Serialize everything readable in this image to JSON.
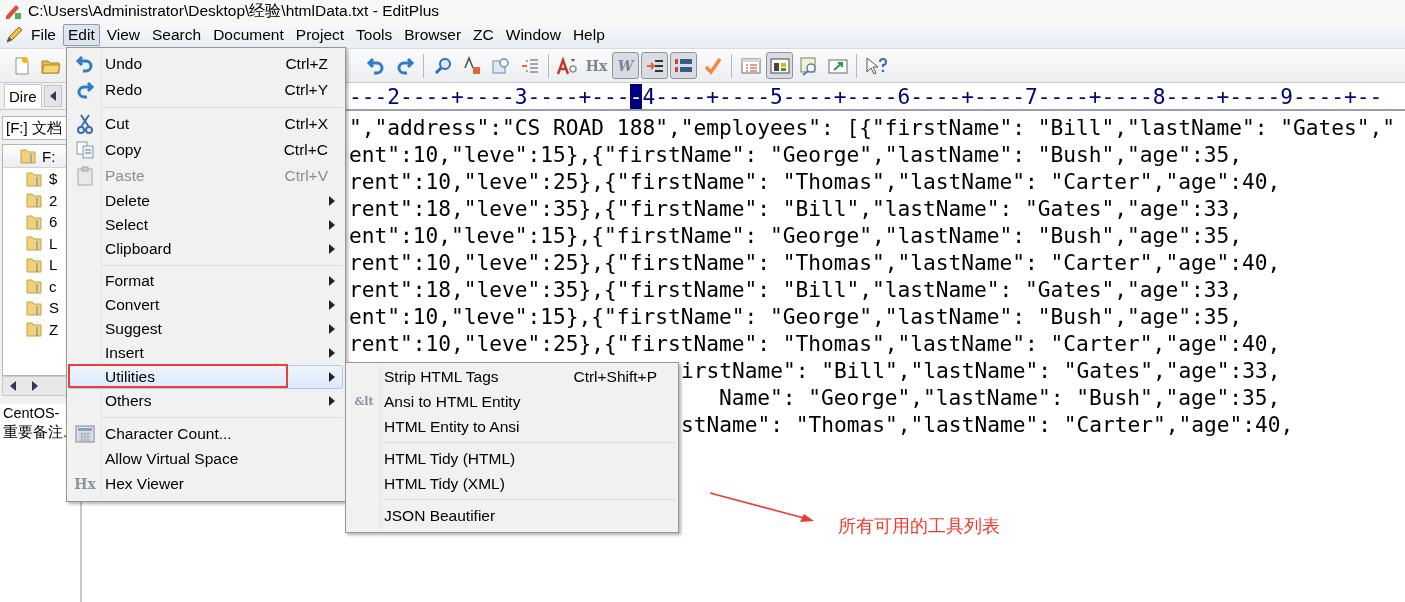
{
  "window": {
    "title": "C:\\Users\\Administrator\\Desktop\\经验\\htmlData.txt - EditPlus"
  },
  "menu_bar": [
    {
      "label": "File",
      "selected": false
    },
    {
      "label": "Edit",
      "selected": true
    },
    {
      "label": "View",
      "selected": false
    },
    {
      "label": "Search",
      "selected": false
    },
    {
      "label": "Document",
      "selected": false
    },
    {
      "label": "Project",
      "selected": false
    },
    {
      "label": "Tools",
      "selected": false
    },
    {
      "label": "Browser",
      "selected": false
    },
    {
      "label": "ZC",
      "selected": false
    },
    {
      "label": "Window",
      "selected": false
    },
    {
      "label": "Help",
      "selected": false
    }
  ],
  "toolbar_left": [
    {
      "kind": "button",
      "pressed": false
    },
    {
      "kind": "button",
      "pressed": false
    }
  ],
  "toolbar": [
    {
      "kind": "button",
      "pressed": false
    },
    {
      "kind": "button",
      "pressed": false
    },
    {
      "kind": "separator"
    },
    {
      "kind": "button",
      "pressed": false
    },
    {
      "kind": "button",
      "pressed": false
    },
    {
      "kind": "button",
      "pressed": false
    },
    {
      "kind": "button",
      "pressed": false
    },
    {
      "kind": "separator"
    },
    {
      "kind": "button",
      "pressed": false
    },
    {
      "kind": "text",
      "label": "Hx",
      "pressed": false
    },
    {
      "kind": "text",
      "label": "W",
      "pressed": true
    },
    {
      "kind": "button",
      "pressed": true
    },
    {
      "kind": "button",
      "pressed": true
    },
    {
      "kind": "button",
      "pressed": false
    },
    {
      "kind": "separator"
    },
    {
      "kind": "button",
      "pressed": false
    },
    {
      "kind": "button",
      "pressed": true
    },
    {
      "kind": "button",
      "pressed": false
    },
    {
      "kind": "button",
      "pressed": false
    },
    {
      "kind": "separator"
    },
    {
      "kind": "button",
      "pressed": false
    }
  ],
  "directory_panel": {
    "tab": "Dire",
    "drive": "[F:] 文档",
    "tree": {
      "label": "F:",
      "children": [
        {
          "label": "$"
        },
        {
          "label": "2"
        },
        {
          "label": "6"
        },
        {
          "label": "L"
        },
        {
          "label": "L"
        },
        {
          "label": "c"
        },
        {
          "label": "S"
        },
        {
          "label": "Z"
        }
      ]
    },
    "files": [
      "CentOS-",
      "重要备注."
    ]
  },
  "ruler": {
    "before": "---2----+----3----+---",
    "cursor": "-",
    "after": "4----+----5----+----6----+----7----+----8----+----9----+--"
  },
  "code_lines": [
    "\",\"address\":\"CS ROAD 188\",\"employees\": [{\"firstName\": \"Bill\",\"lastName\": \"Gates\",\"",
    "ent\":10,\"leve\":15},{\"firstName\": \"George\",\"lastName\": \"Bush\",\"age\":35,",
    "rent\":10,\"leve\":25},{\"firstName\": \"Thomas\",\"lastName\": \"Carter\",\"age\":40,",
    "rent\":18,\"leve\":35},{\"firstName\": \"Bill\",\"lastName\": \"Gates\",\"age\":33,",
    "ent\":10,\"leve\":15},{\"firstName\": \"George\",\"lastName\": \"Bush\",\"age\":35,",
    "rent\":10,\"leve\":25},{\"firstName\": \"Thomas\",\"lastName\": \"Carter\",\"age\":40,",
    "rent\":18,\"leve\":35},{\"firstName\": \"Bill\",\"lastName\": \"Gates\",\"age\":33,",
    "ent\":10,\"leve\":15},{\"firstName\": \"George\",\"lastName\": \"Bush\",\"age\":35,",
    "rent\":10,\"leve\":25},{\"firstName\": \"Thomas\",\"lastName\": \"Carter\",\"age\":40,",
    "irstName\": \"Bill\",\"lastName\": \"Gates\",\"age\":33,",
    "Name\": \"George\",\"lastName\": \"Bush\",\"age\":35,",
    "stName\": \"Thomas\",\"lastName\": \"Carter\",\"age\":40,"
  ],
  "edit_menu": [
    {
      "kind": "item",
      "label": "Undo",
      "shortcut": "Ctrl+Z",
      "submenu": false,
      "disabled": false,
      "selected": false
    },
    {
      "kind": "item",
      "label": "Redo",
      "shortcut": "Ctrl+Y",
      "submenu": false,
      "disabled": false,
      "selected": false
    },
    {
      "kind": "separator"
    },
    {
      "kind": "item",
      "label": "Cut",
      "shortcut": "Ctrl+X",
      "submenu": false,
      "disabled": false,
      "selected": false
    },
    {
      "kind": "item",
      "label": "Copy",
      "shortcut": "Ctrl+C",
      "submenu": false,
      "disabled": false,
      "selected": false
    },
    {
      "kind": "item",
      "label": "Paste",
      "shortcut": "Ctrl+V",
      "submenu": false,
      "disabled": true,
      "selected": false
    },
    {
      "kind": "item",
      "label": "Delete",
      "submenu": true,
      "disabled": false,
      "selected": false
    },
    {
      "kind": "item",
      "label": "Select",
      "submenu": true,
      "disabled": false,
      "selected": false
    },
    {
      "kind": "item",
      "label": "Clipboard",
      "submenu": true,
      "disabled": false,
      "selected": false
    },
    {
      "kind": "separator"
    },
    {
      "kind": "item",
      "label": "Format",
      "submenu": true,
      "disabled": false,
      "selected": false
    },
    {
      "kind": "item",
      "label": "Convert",
      "submenu": true,
      "disabled": false,
      "selected": false
    },
    {
      "kind": "item",
      "label": "Suggest",
      "submenu": true,
      "disabled": false,
      "selected": false
    },
    {
      "kind": "item",
      "label": "Insert",
      "submenu": true,
      "disabled": false,
      "selected": false
    },
    {
      "kind": "item",
      "label": "Utilities",
      "submenu": true,
      "disabled": false,
      "selected": true
    },
    {
      "kind": "item",
      "label": "Others",
      "submenu": true,
      "disabled": false,
      "selected": false
    },
    {
      "kind": "separator"
    },
    {
      "kind": "item",
      "label": "Character Count...",
      "submenu": false,
      "disabled": false,
      "selected": false
    },
    {
      "kind": "item",
      "label": "Allow Virtual Space",
      "submenu": false,
      "disabled": false,
      "selected": false
    },
    {
      "kind": "item",
      "label": "Hex Viewer",
      "icon_text": "Hx",
      "submenu": false,
      "disabled": false,
      "selected": false
    }
  ],
  "utilities_menu": [
    {
      "kind": "item",
      "label": "Strip HTML Tags",
      "shortcut": "Ctrl+Shift+P"
    },
    {
      "kind": "item",
      "label": "Ansi to HTML Entity",
      "icon_text": "&lt"
    },
    {
      "kind": "item",
      "label": "HTML Entity to Ansi"
    },
    {
      "kind": "separator"
    },
    {
      "kind": "item",
      "label": "HTML Tidy (HTML)"
    },
    {
      "kind": "item",
      "label": "HTML Tidy (XML)"
    },
    {
      "kind": "separator"
    },
    {
      "kind": "item",
      "label": "JSON Beautifier"
    }
  ],
  "annotation": {
    "text": "所有可用的工具列表"
  }
}
